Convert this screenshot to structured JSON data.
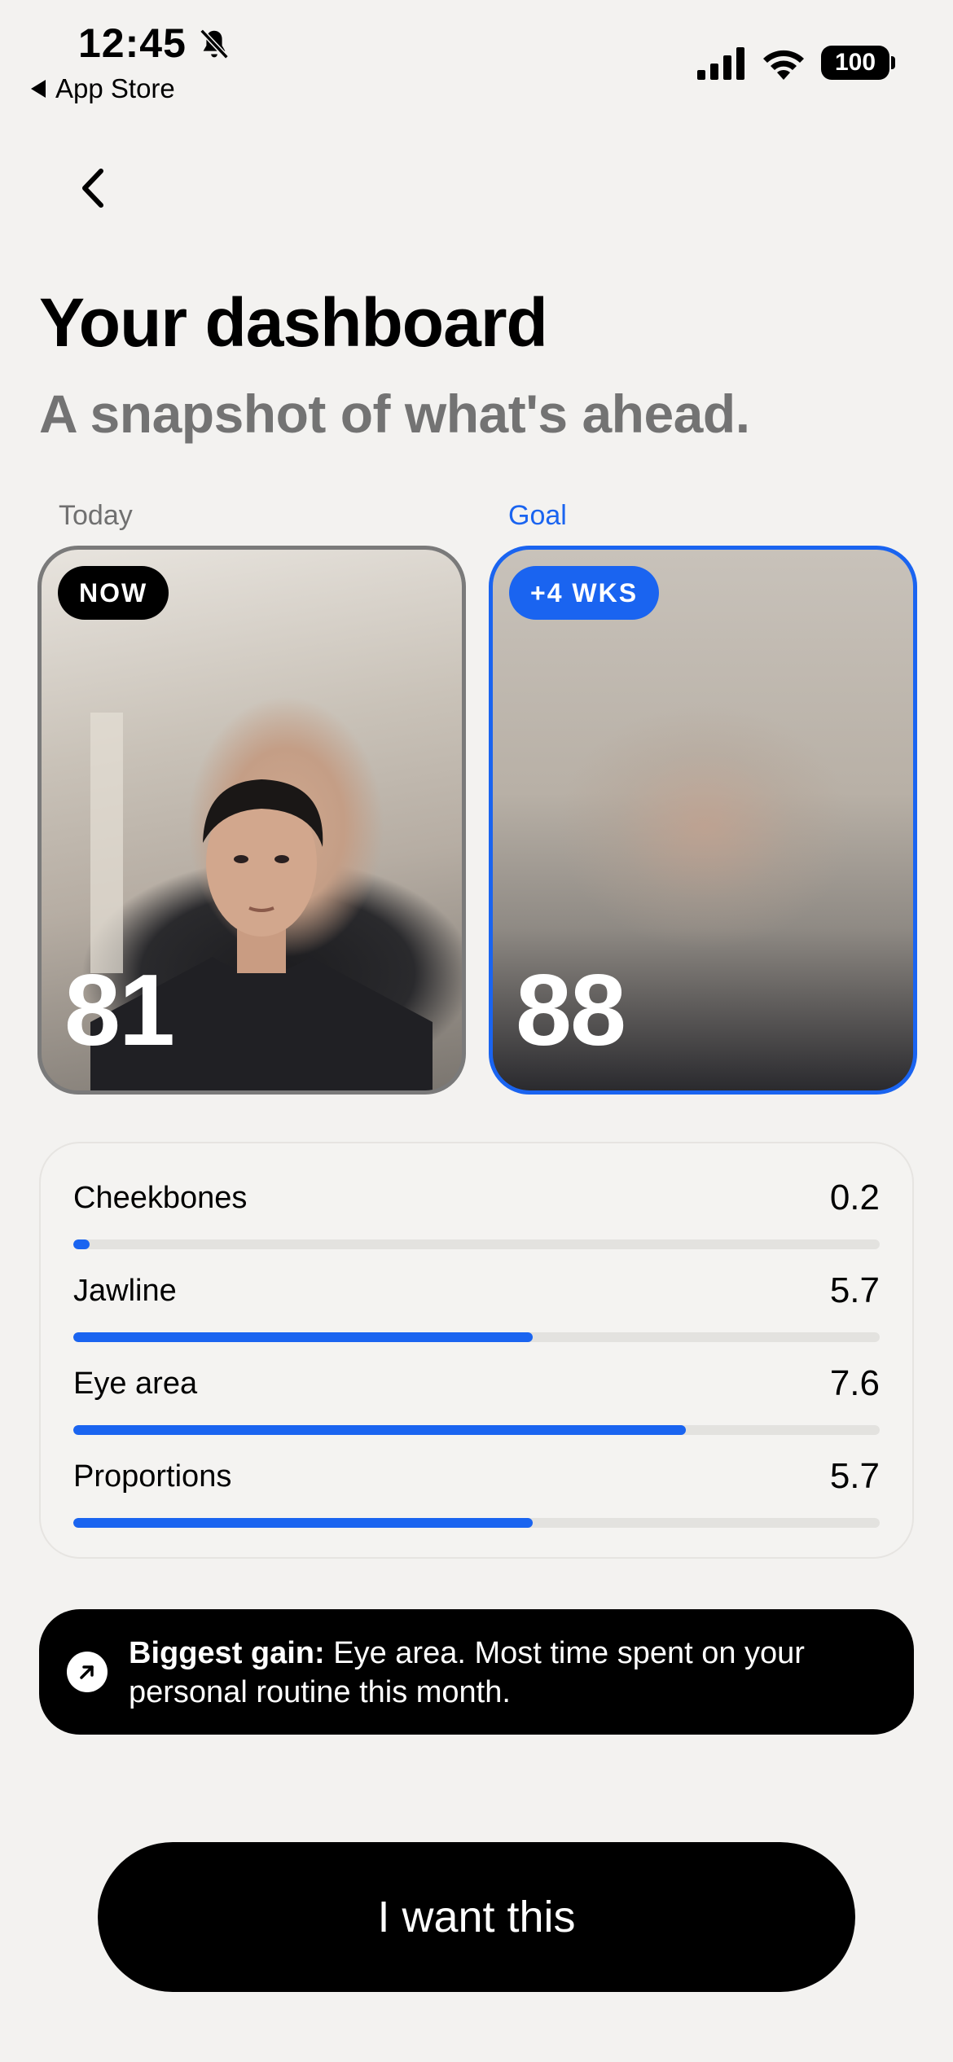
{
  "status_bar": {
    "time": "12:45",
    "back_app": "App Store",
    "battery": "100"
  },
  "header": {
    "title": "Your dashboard",
    "subtitle": "A snapshot of what's ahead."
  },
  "cards": {
    "today": {
      "label": "Today",
      "badge": "NOW",
      "score": "81"
    },
    "goal": {
      "label": "Goal",
      "badge": "+4 WKS",
      "score": "88"
    }
  },
  "metrics": [
    {
      "label": "Cheekbones",
      "value": "0.2",
      "fraction": 0.02
    },
    {
      "label": "Jawline",
      "value": "5.7",
      "fraction": 0.57
    },
    {
      "label": "Eye area",
      "value": "7.6",
      "fraction": 0.76
    },
    {
      "label": "Proportions",
      "value": "5.7",
      "fraction": 0.57
    }
  ],
  "callout": {
    "bold": "Biggest gain:",
    "text": " Eye area. Most time spent on your personal routine this month."
  },
  "cta": {
    "label": "I want this"
  },
  "colors": {
    "accent": "#1a64f0",
    "background": "#f3f2f0"
  },
  "icons": [
    "bell-muted-icon",
    "signal-icon",
    "wifi-icon",
    "battery-icon",
    "chevron-left-icon",
    "arrow-up-right-icon"
  ]
}
